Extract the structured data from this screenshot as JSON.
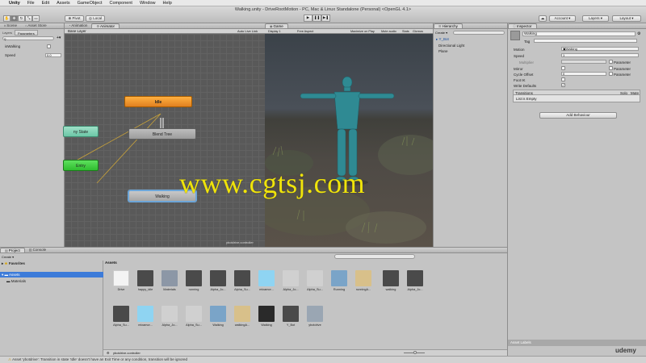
{
  "menubar": {
    "app": "Unity",
    "items": [
      "File",
      "Edit",
      "Assets",
      "GameObject",
      "Component",
      "Window",
      "Help"
    ]
  },
  "toolbar": {
    "title": "Walking.unity - DriveRootMotion - PC, Mac & Linux Standalone (Personal) <OpenGL 4.1>",
    "pivot": "Pivot",
    "local": "Local",
    "account": "Account",
    "layers": "Layers",
    "layout": "Layout"
  },
  "left_panel": {
    "tabs": [
      "Scene",
      "Asset Store"
    ],
    "subtabs": [
      "Layers",
      "Parameters"
    ],
    "params": [
      {
        "name": "isWalking",
        "type": "bool",
        "value": ""
      },
      {
        "name": "Speed",
        "type": "float",
        "value": "0.0"
      }
    ]
  },
  "animator": {
    "tabs": [
      "Animation",
      "Animator"
    ],
    "breadcrumb": "Base Layer",
    "auto_live": "Auto Live Link",
    "nodes": {
      "idle": "Idle",
      "any_state": "ny State",
      "blend_tree": "Blend Tree",
      "entry": "Entry",
      "walking": "Walking"
    },
    "footer": "ybotdrive.controller"
  },
  "game": {
    "tab": "Game",
    "display": "Display 1",
    "aspect": "Free Aspect",
    "maximize": "Maximize on Play",
    "mute": "Mute audio",
    "stats": "Stats",
    "gizmos": "Gizmos"
  },
  "hierarchy": {
    "tab": "Hierarchy",
    "create": "Create",
    "items": [
      "Y_Bot",
      "Directional Light",
      "Plane"
    ]
  },
  "inspector": {
    "tab": "Inspector",
    "name": "Walking",
    "tag_label": "Tag",
    "rows": [
      {
        "label": "Motion",
        "value": "Walking"
      },
      {
        "label": "Speed",
        "value": "1"
      },
      {
        "label": "Multiplier",
        "value": ""
      },
      {
        "label": "Mirror",
        "value": ""
      },
      {
        "label": "Cycle Offset",
        "value": "0"
      },
      {
        "label": "Foot IK",
        "value": ""
      },
      {
        "label": "Write Defaults",
        "value": ""
      }
    ],
    "parameter_label": "Parameter",
    "transitions": "Transitions",
    "solo": "Solo",
    "mute": "Mute",
    "list_empty": "List is Empty",
    "add_behaviour": "Add Behaviour",
    "asset_labels": "Asset Labels"
  },
  "project": {
    "tabs": [
      "Project",
      "Console"
    ],
    "create": "Create",
    "favorites": "Favorites",
    "assets_root": "Assets",
    "materials": "Materials",
    "breadcrumb": "Assets",
    "footer_file": "ybotdrive.controller",
    "assets_row1": [
      "Drive",
      "happy_idle",
      "Materials",
      "running",
      "Alpha_Jo...",
      "Alpha_Su...",
      "mixamor...",
      "Alpha_Jo...",
      "Alpha_Su...",
      "Running",
      "runningA...",
      "walking",
      "Alpha_Jo..."
    ],
    "assets_row2": [
      "Alpha_Su...",
      "mixamor...",
      "Alpha_Jo...",
      "Alpha_Su...",
      "Walking",
      "walkingA...",
      "Walking",
      "Y_Bot",
      "ybotdrive"
    ]
  },
  "status": "Asset 'ybotdrive': Transition in state 'Idle' doesn't have an Exit Time or any condition, transition will be ignored",
  "watermark": "www.cgtsj.com",
  "brand": "udemy"
}
